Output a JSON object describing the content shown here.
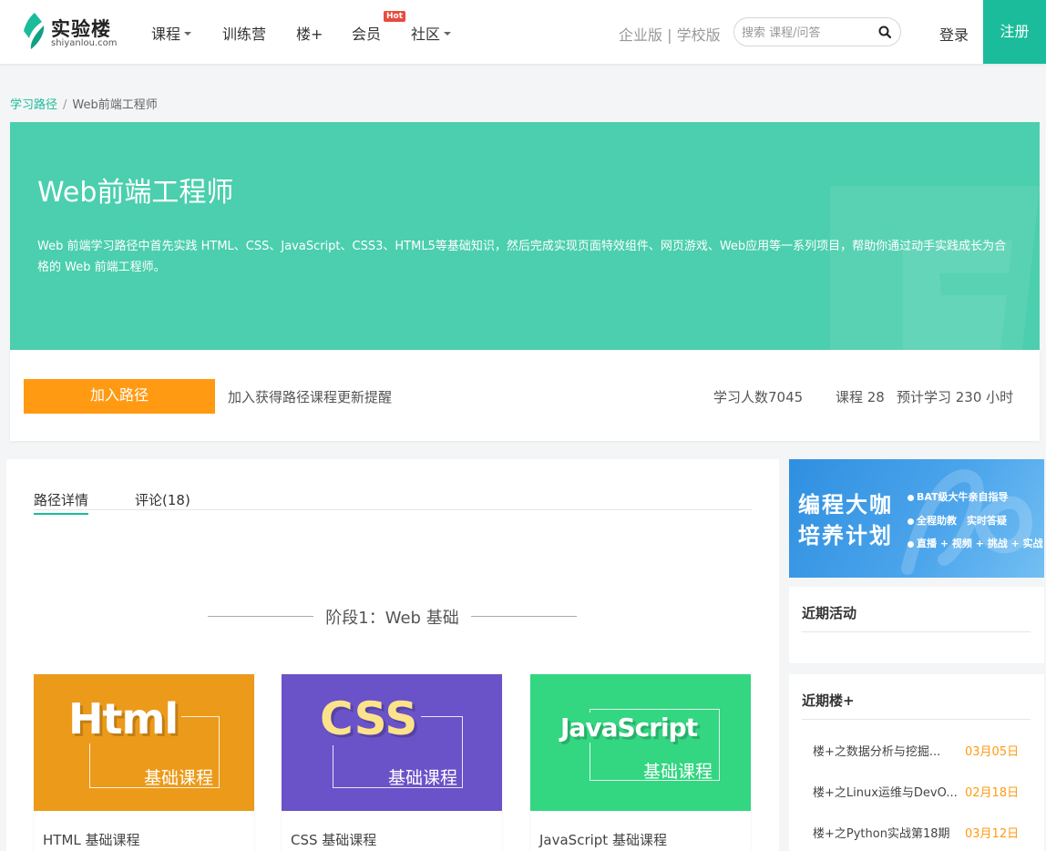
{
  "header": {
    "logo_cn": "实验楼",
    "logo_en": "shiyanlou.com",
    "nav": [
      {
        "label": "课程",
        "dropdown": true
      },
      {
        "label": "训练营",
        "dropdown": false
      },
      {
        "label": "楼+",
        "dropdown": false
      },
      {
        "label": "会员",
        "dropdown": false,
        "badge": "Hot"
      },
      {
        "label": "社区",
        "dropdown": true
      }
    ],
    "edition_links": "企业版 | 学校版",
    "search_placeholder": "搜索 课程/问答",
    "login": "登录",
    "register": "注册"
  },
  "breadcrumb": {
    "parent": "学习路径",
    "separator": "/",
    "current": "Web前端工程师"
  },
  "banner": {
    "title": "Web前端工程师",
    "description": "Web 前端学习路径中首先实践 HTML、CSS、JavaScript、CSS3、HTML5等基础知识，然后完成实现页面特效组件、网页游戏、Web应用等一系列项目，帮助你通过动手实践成长为合格的 Web 前端工程师。",
    "color": "#4bcfae"
  },
  "path_info": {
    "join_button": "加入路径",
    "join_hint": "加入获得路径课程更新提醒",
    "learners": "学习人数7045",
    "courses": "课程 28",
    "hours": "预计学习 230 小时"
  },
  "tabs": [
    {
      "label": "路径详情",
      "active": true
    },
    {
      "label": "评论(18)",
      "active": false
    }
  ],
  "stage": {
    "title": "阶段1：Web 基础"
  },
  "courses": [
    {
      "big": "Html",
      "sub": "基础课程",
      "name": "HTML 基础课程",
      "bg": "#ec9a1a",
      "big_color": "#ffffff"
    },
    {
      "big": "CSS",
      "sub": "基础课程",
      "name": "CSS 基础课程",
      "bg": "#6a52c8",
      "big_color": "#fce38a"
    },
    {
      "big": "JavaScript",
      "sub": "基础课程",
      "name": "JavaScript 基础课程",
      "bg": "#33d681",
      "big_color": "#ffffff"
    }
  ],
  "promo": {
    "title_line1": "编程大咖",
    "title_line2": "培养计划",
    "bullets": [
      "BAT级大牛亲自指导",
      "全程助教　实时答疑",
      "直播 + 视频 + 挑战 + 实战"
    ]
  },
  "sidebar": {
    "activities_title": "近期活动",
    "lou_plus_title": "近期楼+",
    "lou_plus_items": [
      {
        "title": "楼+之数据分析与挖掘...",
        "date": "03月05日"
      },
      {
        "title": "楼+之Linux运维与DevO...",
        "date": "02月18日"
      },
      {
        "title": "楼+之Python实战第18期",
        "date": "03月12日"
      }
    ]
  },
  "colors": {
    "brand": "#1bbc9b",
    "accent": "#ff9a12"
  }
}
